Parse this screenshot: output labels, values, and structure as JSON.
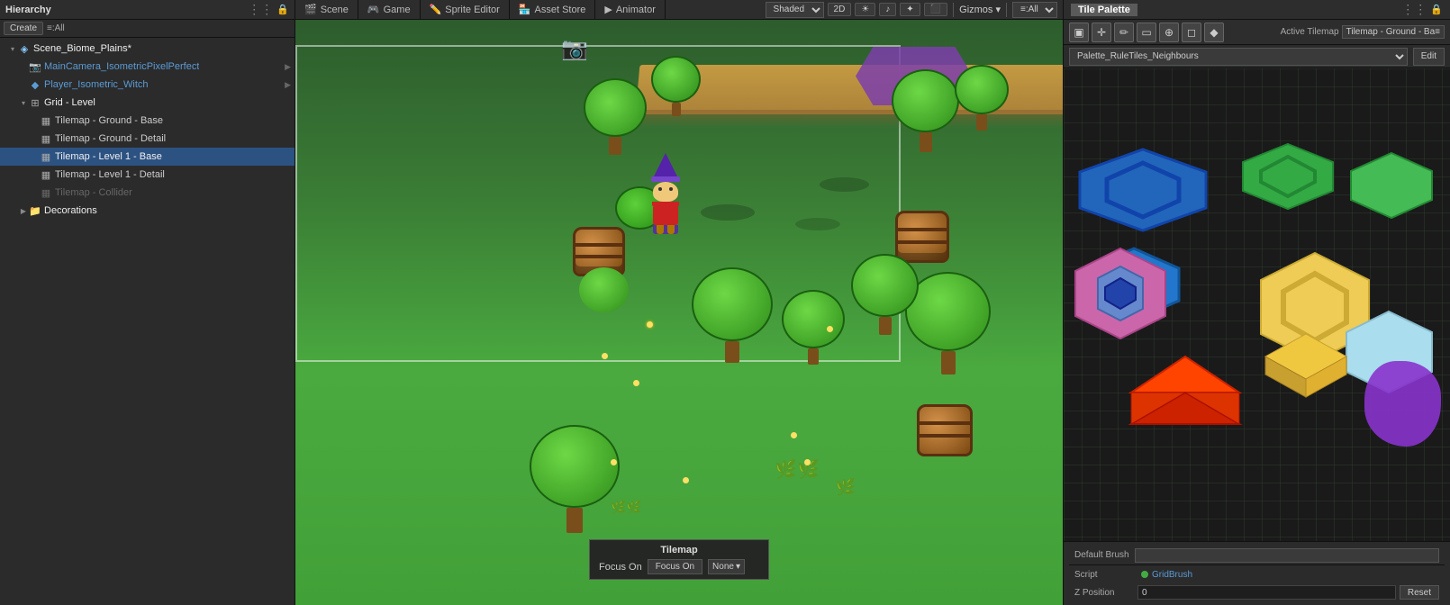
{
  "topBar": {
    "tabs": [
      {
        "id": "scene",
        "label": "Scene",
        "icon": "🎬",
        "active": false
      },
      {
        "id": "game",
        "label": "Game",
        "icon": "🎮",
        "active": false
      },
      {
        "id": "sprite-editor",
        "label": "Sprite Editor",
        "icon": "✏️",
        "active": false
      },
      {
        "id": "asset-store",
        "label": "Asset Store",
        "icon": "🏪",
        "active": false
      },
      {
        "id": "animator",
        "label": "Animator",
        "icon": "▶",
        "active": false
      }
    ],
    "shaded": "Shaded",
    "mode2d": "2D",
    "gizmos": "Gizmos",
    "gizmosAll": "≡:All",
    "all": "≡:All"
  },
  "hierarchy": {
    "title": "Hierarchy",
    "createLabel": "Create",
    "allLabel": "≡:All",
    "searchPlaceholder": "",
    "items": [
      {
        "id": "scene",
        "label": "Scene_Biome_Plains*",
        "level": 0,
        "hasArrow": true,
        "arrowDown": true,
        "icon": "scene",
        "color": "white",
        "selected": false
      },
      {
        "id": "camera",
        "label": "MainCamera_IsometricPixelPerfect",
        "level": 1,
        "hasArrow": false,
        "icon": "camera",
        "color": "blue",
        "selected": false,
        "hasExpand": true
      },
      {
        "id": "player",
        "label": "Player_Isometric_Witch",
        "level": 1,
        "hasArrow": false,
        "icon": "gameobj",
        "color": "blue",
        "selected": false,
        "hasExpand": true
      },
      {
        "id": "grid",
        "label": "Grid - Level",
        "level": 1,
        "hasArrow": true,
        "arrowDown": true,
        "icon": "grid",
        "color": "white",
        "selected": false
      },
      {
        "id": "tm-ground-base",
        "label": "Tilemap - Ground - Base",
        "level": 2,
        "hasArrow": false,
        "icon": "tilemap",
        "color": "white",
        "selected": false
      },
      {
        "id": "tm-ground-detail",
        "label": "Tilemap - Ground - Detail",
        "level": 2,
        "hasArrow": false,
        "icon": "tilemap",
        "color": "white",
        "selected": false
      },
      {
        "id": "tm-level1-base",
        "label": "Tilemap - Level 1 - Base",
        "level": 2,
        "hasArrow": false,
        "icon": "tilemap",
        "color": "white",
        "selected": true
      },
      {
        "id": "tm-level1-detail",
        "label": "Tilemap - Level 1 - Detail",
        "level": 2,
        "hasArrow": false,
        "icon": "tilemap",
        "color": "white",
        "selected": false
      },
      {
        "id": "tm-collider",
        "label": "Tilemap - Collider",
        "level": 2,
        "hasArrow": false,
        "icon": "tilemap",
        "color": "gray",
        "selected": false
      },
      {
        "id": "decorations",
        "label": "Decorations",
        "level": 1,
        "hasArrow": true,
        "arrowDown": false,
        "icon": "folder",
        "color": "white",
        "selected": false
      }
    ]
  },
  "sceneView": {
    "toolbar": {
      "shaded": "Shaded",
      "mode2d": "2D",
      "gizmos": "Gizmos ▾",
      "all": "≡:All"
    }
  },
  "tilePalette": {
    "title": "Tile Palette",
    "tools": [
      {
        "id": "select",
        "label": "▣",
        "active": false
      },
      {
        "id": "move",
        "label": "✛",
        "active": false
      },
      {
        "id": "paint",
        "label": "✏",
        "active": false
      },
      {
        "id": "rect",
        "label": "▭",
        "active": false
      },
      {
        "id": "picker",
        "label": "⊕",
        "active": false
      },
      {
        "id": "eraser",
        "label": "◻",
        "active": false
      },
      {
        "id": "fill",
        "label": "⬥",
        "active": false
      }
    ],
    "activeTilemapLabel": "Active Tilemap",
    "activeTilemapValue": "Tilemap - Ground - Ba≡",
    "paletteLabel": "Palette_RuleTiles_Neighbours",
    "editLabel": "Edit",
    "defaultBrushLabel": "Default Brush",
    "scriptLabel": "Script",
    "scriptValue": "GridBrush",
    "zPositionLabel": "Z Position",
    "zPositionValue": "0",
    "resetLabel": "Reset"
  },
  "tilemapPopup": {
    "title": "Tilemap",
    "focusOnLabel": "Focus On",
    "noneLabel": "None",
    "noneArrow": "▾"
  }
}
